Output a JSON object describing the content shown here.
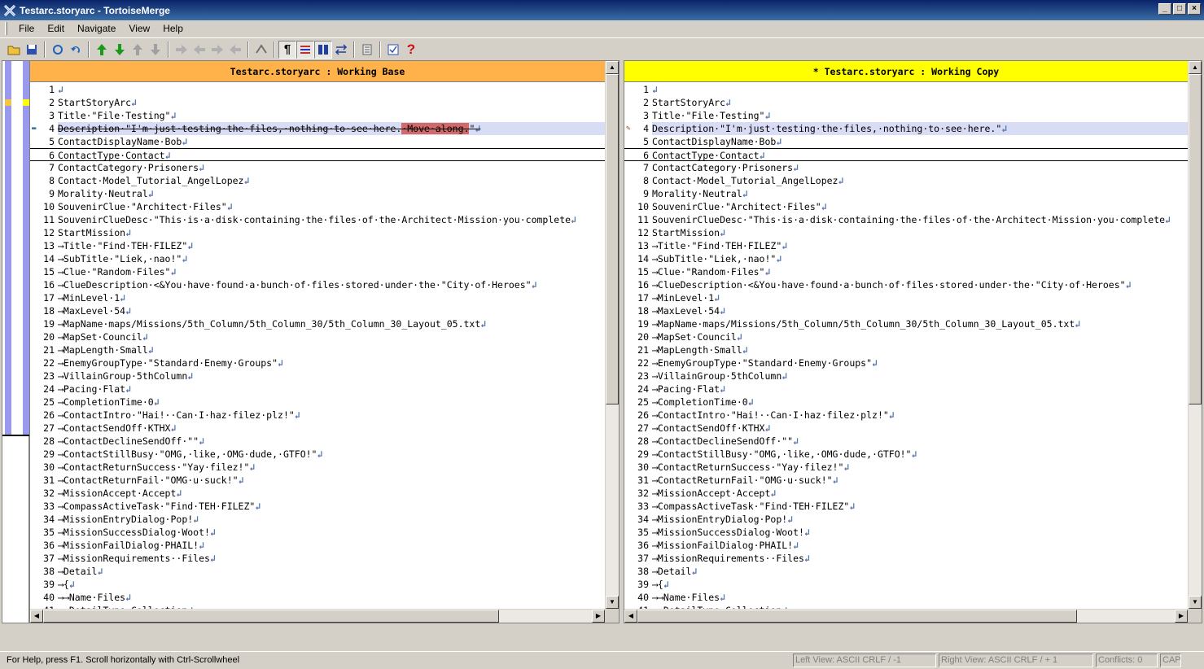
{
  "window": {
    "title": "Testarc.storyarc - TortoiseMerge"
  },
  "menu": [
    "File",
    "Edit",
    "Navigate",
    "View",
    "Help"
  ],
  "toolbar": {
    "icons": [
      "open-icon",
      "save-icon",
      "reload-icon",
      "undo-icon",
      "next-diff-icon",
      "prev-diff-icon",
      "first-diff-icon",
      "last-diff-icon",
      "next-conflict-icon",
      "prev-conflict-icon",
      "first-conflict-icon",
      "last-conflict-icon",
      "mark-icon",
      "whitespace-toggle-icon",
      "inline-diff-icon",
      "oneway-view-icon",
      "switch-views-icon",
      "patch-list-icon",
      "settings-icon",
      "help-icon"
    ]
  },
  "left_pane": {
    "header": "Testarc.storyarc : Working Base",
    "header_color": "#ffb24a"
  },
  "right_pane": {
    "header": "* Testarc.storyarc : Working Copy",
    "header_color": "#ffff00"
  },
  "lines": [
    {
      "n": "1",
      "t": ""
    },
    {
      "n": "2",
      "t": "StartStoryArc"
    },
    {
      "n": "3",
      "t": "Title·\"File·Testing\""
    },
    {
      "n": "4",
      "t": "Description·\"I'm·just·testing·the·files,·nothing·to·see·here.\"",
      "removed": "·Move·along.",
      "changed": true
    },
    {
      "n": "5",
      "t": "ContactDisplayName·Bob"
    },
    {
      "n": "6",
      "t": "ContactType·Contact"
    },
    {
      "n": "7",
      "t": "ContactCategory·Prisoners"
    },
    {
      "n": "8",
      "t": "Contact·Model_Tutorial_AngelLopez"
    },
    {
      "n": "9",
      "t": "Morality·Neutral"
    },
    {
      "n": "10",
      "t": "SouvenirClue·\"Architect·Files\""
    },
    {
      "n": "11",
      "t": "SouvenirClueDesc·\"This·is·a·disk·containing·the·files·of·the·Architect·Mission·you·complete"
    },
    {
      "n": "12",
      "t": "StartMission"
    },
    {
      "n": "13",
      "t": "⟶Title·\"Find·TEH·FILEZ\"",
      "tab": true
    },
    {
      "n": "14",
      "t": "⟶SubTitle·\"Liek,·nao!\"",
      "tab": true
    },
    {
      "n": "15",
      "t": "⟶Clue·\"Random·Files\"",
      "tab": true
    },
    {
      "n": "16",
      "t": "⟶ClueDescription·<&You·have·found·a·bunch·of·files·stored·under·the·\"City·of·Heroes\"",
      "tab": true
    },
    {
      "n": "17",
      "t": "⟶MinLevel·1",
      "tab": true
    },
    {
      "n": "18",
      "t": "⟶MaxLevel·54",
      "tab": true
    },
    {
      "n": "19",
      "t": "⟶MapName·maps/Missions/5th_Column/5th_Column_30/5th_Column_30_Layout_05.txt",
      "tab": true
    },
    {
      "n": "20",
      "t": "⟶MapSet·Council",
      "tab": true
    },
    {
      "n": "21",
      "t": "⟶MapLength·Small",
      "tab": true
    },
    {
      "n": "22",
      "t": "⟶EnemyGroupType·\"Standard·Enemy·Groups\"",
      "tab": true
    },
    {
      "n": "23",
      "t": "⟶VillainGroup·5thColumn",
      "tab": true
    },
    {
      "n": "24",
      "t": "⟶Pacing·Flat",
      "tab": true
    },
    {
      "n": "25",
      "t": "⟶CompletionTime·0",
      "tab": true
    },
    {
      "n": "26",
      "t": "⟶ContactIntro·\"Hai!··Can·I·haz·filez·plz!\"",
      "tab": true
    },
    {
      "n": "27",
      "t": "⟶ContactSendOff·KTHX",
      "tab": true
    },
    {
      "n": "28",
      "t": "⟶ContactDeclineSendOff·\"\"",
      "tab": true
    },
    {
      "n": "29",
      "t": "⟶ContactStillBusy·\"OMG,·like,·OMG·dude,·GTFO!\"",
      "tab": true
    },
    {
      "n": "30",
      "t": "⟶ContactReturnSuccess·\"Yay·filez!\"",
      "tab": true
    },
    {
      "n": "31",
      "t": "⟶ContactReturnFail·\"OMG·u·suck!\"",
      "tab": true
    },
    {
      "n": "32",
      "t": "⟶MissionAccept·Accept",
      "tab": true
    },
    {
      "n": "33",
      "t": "⟶CompassActiveTask·\"Find·TEH·FILEZ\"",
      "tab": true
    },
    {
      "n": "34",
      "t": "⟶MissionEntryDialog·Pop!",
      "tab": true
    },
    {
      "n": "35",
      "t": "⟶MissionSuccessDialog·Woot!",
      "tab": true
    },
    {
      "n": "36",
      "t": "⟶MissionFailDialog·PHAIL!",
      "tab": true
    },
    {
      "n": "37",
      "t": "⟶MissionRequirements··Files",
      "tab": true
    },
    {
      "n": "38",
      "t": "⟶Detail",
      "tab": true
    },
    {
      "n": "39",
      "t": "⟶{",
      "tab": true
    },
    {
      "n": "40",
      "t": "⟶⟶Name·Files",
      "tab": true
    },
    {
      "n": "41",
      "t": "⟶⟶DetailType·Collection",
      "tab": true
    }
  ],
  "status": {
    "help": "For Help, press F1. Scroll horizontally with Ctrl-Scrollwheel",
    "left_view": "Left View: ASCII CRLF / -1",
    "right_view": "Right View: ASCII CRLF / + 1",
    "conflicts": "Conflicts: 0",
    "caps": "CAP"
  }
}
